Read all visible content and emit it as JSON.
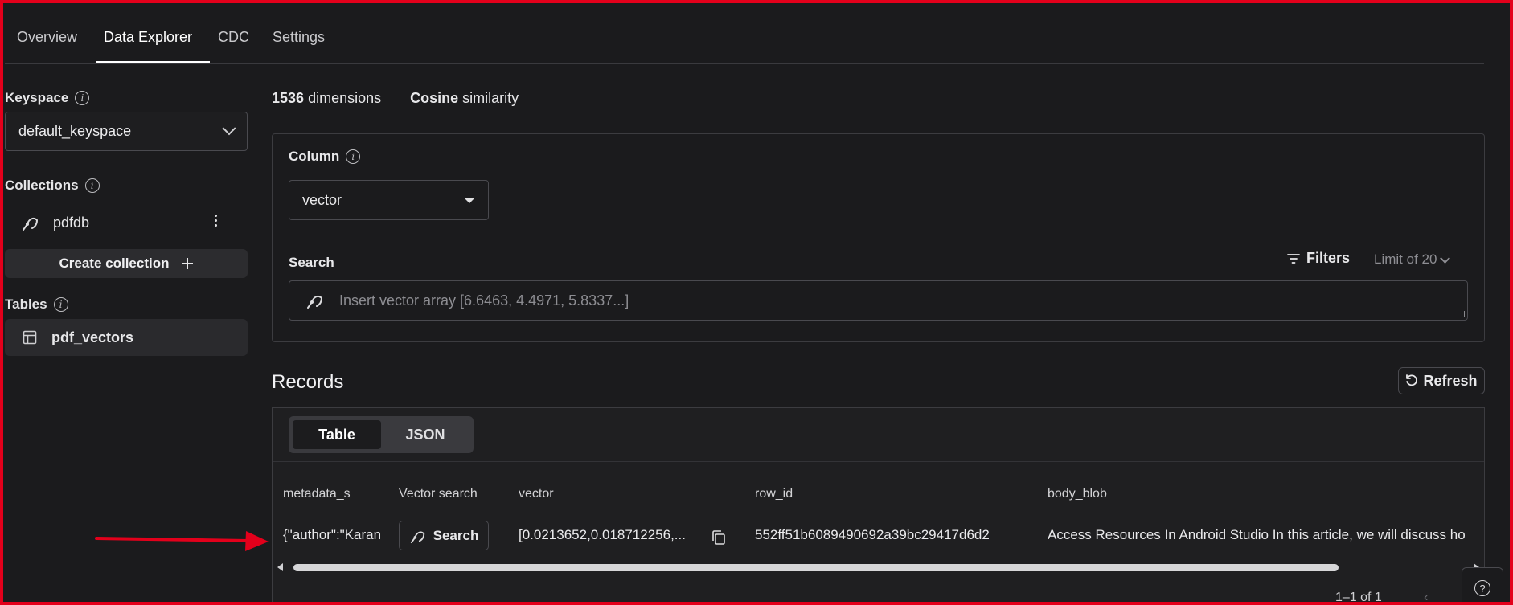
{
  "tabs": [
    {
      "label": "Overview"
    },
    {
      "label": "Data Explorer"
    },
    {
      "label": "CDC"
    },
    {
      "label": "Settings"
    }
  ],
  "sidebar": {
    "keyspace_label": "Keyspace",
    "keyspace_value": "default_keyspace",
    "collections_label": "Collections",
    "collection_name": "pdfdb",
    "create_collection_label": "Create collection",
    "tables_label": "Tables",
    "table_name": "pdf_vectors"
  },
  "main": {
    "dimensions_value": "1536",
    "dimensions_text": "dimensions",
    "similarity_value": "Cosine",
    "similarity_text": "similarity",
    "column_label": "Column",
    "column_value": "vector",
    "search_label": "Search",
    "filters_label": "Filters",
    "limit_label": "Limit of 20",
    "search_placeholder": "Insert vector array [6.6463, 4.4971, 5.8337...]"
  },
  "records": {
    "title": "Records",
    "refresh_label": "Refresh",
    "view_toggle": [
      "Table",
      "JSON"
    ],
    "active_view": "Table",
    "columns": [
      "metadata_s",
      "Vector search",
      "vector",
      "row_id",
      "body_blob"
    ],
    "row": {
      "metadata_s": "{\"author\":\"Karan",
      "vector_search_label": "Search",
      "vector": "[0.0213652,0.018712256,...",
      "row_id": "552ff51b6089490692a39bc29417d6d2",
      "body_blob": "Access Resources In Android Studio In this article, we will discuss ho"
    },
    "pagination": "1–1 of 1"
  },
  "colors": {
    "background": "#1b1b1d",
    "frame": "#e3001b",
    "annotation_arrow": "#e3001b"
  }
}
